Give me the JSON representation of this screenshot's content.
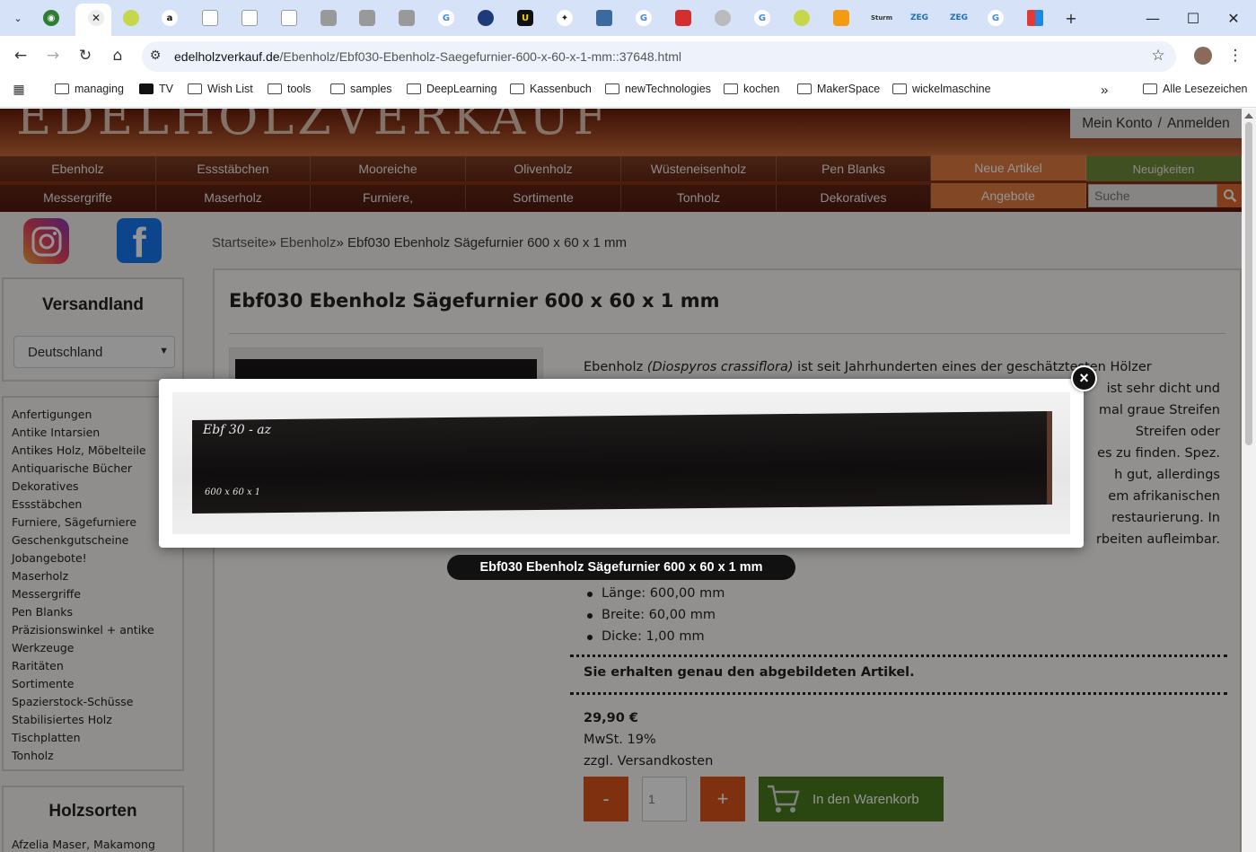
{
  "browser": {
    "tabs_favicons": [
      "google-lens-icon",
      "tennis-ball-icon",
      "tennis-ball-icon",
      "amazon-icon",
      "blank-tab-icon",
      "blank-tab-icon",
      "blank-tab-icon",
      "badge-icon",
      "badge-icon",
      "badge-icon",
      "google-icon",
      "ship-icon",
      "u-badge-icon",
      "figure-icon",
      "pattern-icon",
      "google-icon",
      "lego-icon",
      "circle-icon",
      "google-icon",
      "tennis-ball-icon",
      "orange-icon",
      "sturm-icon",
      "zeg-icon",
      "zeg-icon",
      "google-icon",
      "grid-icon"
    ],
    "tab_text_amazon": "a",
    "tab_text_u": "U",
    "tab_text_sturm": "Sturm",
    "tab_text_zeg1": "ZEG",
    "tab_text_zeg2": "ZEG",
    "url_domain": "edelholzverkauf.de",
    "url_path": "/Ebenholz/Ebf030-Ebenholz-Saegefurnier-600-x-60-x-1-mm::37648.html",
    "bookmarks": [
      "managing",
      "TV",
      "Wish List",
      "tools",
      "samples",
      "DeepLearning",
      "Kassenbuch",
      "newTechnologies",
      "kochen",
      "MakerSpace",
      "wickelmaschine"
    ],
    "bookmarks_more": "»",
    "all_bookmarks": "Alle Lesezeichen"
  },
  "site": {
    "konto": "Mein Konto",
    "sep": "/",
    "anmelden": "Anmelden",
    "menu_row1": [
      "Ebenholz",
      "Essstäbchen",
      "Mooreiche",
      "Olivenholz",
      "Wüsteneisenholz",
      "Pen Blanks"
    ],
    "menu_row2": [
      "Messergriffe",
      "Maserholz",
      "Furniere,",
      "Sortimente",
      "Tonholz",
      "Dekoratives"
    ],
    "neue_artikel": "Neue Artikel",
    "neuigkeiten": "Neuigkeiten",
    "angebote": "Angebote",
    "search_placeholder": "Suche"
  },
  "breadcrumb": {
    "home": "Startseite",
    "sep": "»",
    "category": "Ebenholz",
    "current": "Ebf030 Ebenholz Sägefurnier 600 x 60 x 1 mm"
  },
  "sidebar": {
    "versand_title": "Versandland",
    "country_selected": "Deutschland",
    "categories": [
      "Anfertigungen",
      "Antike Intarsien",
      "Antikes Holz, Möbelteile",
      "Antiquarische Bücher",
      "Dekoratives",
      "Essstäbchen",
      "Furniere, Sägefurniere",
      "Geschenkgutscheine",
      "Jobangebote!",
      "Maserholz",
      "Messergriffe",
      "Pen Blanks",
      "Präzisionswinkel + antike",
      "Werkzeuge",
      "Raritäten",
      "Sortimente",
      "Spazierstock-Schüsse",
      "Stabilisiertes Holz",
      "Tischplatten",
      "Tonholz"
    ],
    "holzsorten_title": "Holzsorten",
    "holzsorten_first": "Afzelia Maser, Makamong"
  },
  "product": {
    "title": "Ebf030 Ebenholz Sägefurnier 600 x 60 x 1 mm",
    "desc_line1_a": "Ebenholz ",
    "desc_line1_b": "(Diospyros crassiflora)",
    "desc_line1_c": " ist seit Jahrhunderten eines der geschätztesten Hölzer",
    "desc_fragments": [
      "ist sehr dicht und",
      "mal graue Streifen",
      "Streifen oder",
      "es zu finden. Spez.",
      "h gut, allerdings",
      "em afrikanischen",
      "restaurierung. In",
      "rbeiten aufleimbar."
    ],
    "specs": [
      "Länge: 600,00 mm",
      "Breite: 60,00 mm",
      "Dicke: 1,00 mm"
    ],
    "notice": "Sie erhalten genau den abgebildeten Artikel.",
    "price": "29,90 €",
    "tax": "MwSt. 19%",
    "shipping": "zzgl. Versandkosten",
    "minus": "-",
    "qty": "1",
    "plus": "+",
    "cart": "In den Warenkorb"
  },
  "lightbox": {
    "caption": "Ebf030 Ebenholz Sägefurnier 600 x 60 x 1 mm",
    "close": "×",
    "photo_mark1": "Ebf 30 - az",
    "photo_mark2": "600 x 60 x 1"
  },
  "colors": {
    "menu_orange": "#e07a40",
    "menu_green": "#6f8a3a",
    "cart_green": "#4a7a1e",
    "qty_orange": "#d9541b"
  }
}
